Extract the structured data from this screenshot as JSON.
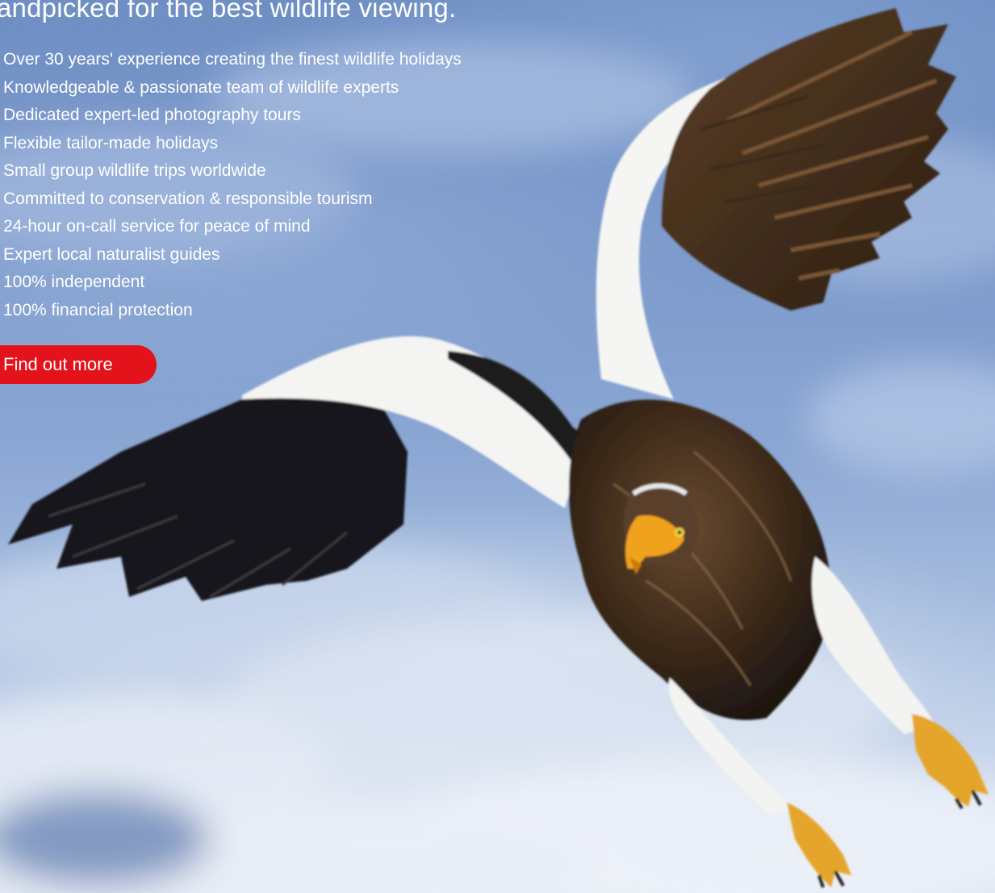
{
  "hero": {
    "headline": "andpicked for the best wildlife viewing.",
    "benefits": [
      "Over 30 years' experience creating the finest wildlife holidays",
      "Knowledgeable & passionate team of wildlife experts",
      "Dedicated expert-led photography tours",
      "Flexible tailor-made holidays",
      "Small group wildlife trips worldwide",
      "Committed to conservation & responsible tourism",
      "24-hour on-call service for peace of mind",
      "Expert local naturalist guides",
      "100% independent",
      "100% financial protection"
    ],
    "cta_label": "Find out more",
    "colors": {
      "cta_background": "#e3121b",
      "text": "#ffffff",
      "sky": "#7d9bcc"
    }
  }
}
